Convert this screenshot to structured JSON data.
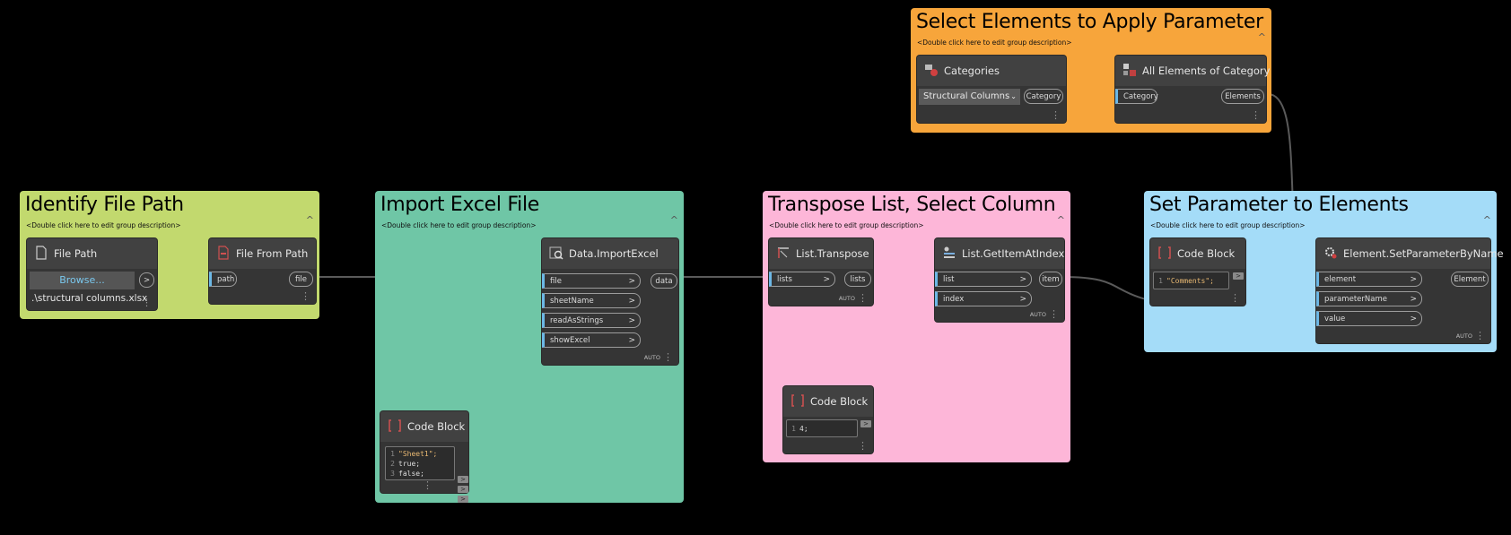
{
  "groups": {
    "select_elements": {
      "title": "Select Elements to Apply Parameter",
      "desc": "<Double click here to edit group description>",
      "color": "#f7a53b"
    },
    "identify_path": {
      "title": "Identify File Path",
      "desc": "<Double click here to edit group description>",
      "color": "#c2d96e"
    },
    "import_excel": {
      "title": "Import Excel File",
      "desc": "<Double click here to edit group description>",
      "color": "#6fc6a6"
    },
    "transpose": {
      "title": "Transpose List, Select Column",
      "desc": "<Double click here to edit group description>",
      "color": "#fdb6d8"
    },
    "set_param": {
      "title": "Set Parameter to Elements",
      "desc": "<Double click here to edit group description>",
      "color": "#a4dcf8"
    }
  },
  "nodes": {
    "categories": {
      "title": "Categories",
      "dropdown": "Structural Columns",
      "out": "Category",
      "icon": "categories-icon"
    },
    "all_elements": {
      "title": "All Elements of Category",
      "in": "Category",
      "out": "Elements",
      "icon": "all-elements-icon"
    },
    "file_path": {
      "title": "File Path",
      "button": "Browse...",
      "out": ">",
      "value": ".\\structural columns.xlsx",
      "icon": "file-icon"
    },
    "file_from_path": {
      "title": "File From Path",
      "in": "path",
      "out": "file",
      "icon": "file-from-path-icon"
    },
    "import_excel": {
      "title": "Data.ImportExcel",
      "inputs": [
        "file",
        "sheetName",
        "readAsStrings",
        "showExcel"
      ],
      "out": "data",
      "lacing": "AUTO",
      "icon": "import-excel-icon"
    },
    "code_block_1": {
      "title": "Code Block",
      "lines": [
        "\"Sheet1\";",
        "true;",
        "false;"
      ]
    },
    "transpose": {
      "title": "List.Transpose",
      "in": "lists",
      "out": "lists",
      "lacing": "AUTO",
      "icon": "transpose-icon"
    },
    "get_item": {
      "title": "List.GetItemAtIndex",
      "inputs": [
        "list",
        "index"
      ],
      "out": "item",
      "lacing": "AUTO",
      "icon": "get-item-icon"
    },
    "code_block_2": {
      "title": "Code Block",
      "lines": [
        "4;"
      ]
    },
    "code_block_3": {
      "title": "Code Block",
      "lines": [
        "\"Comments\";"
      ]
    },
    "set_param": {
      "title": "Element.SetParameterByName",
      "inputs": [
        "element",
        "parameterName",
        "value"
      ],
      "out": "Element",
      "lacing": "AUTO",
      "icon": "set-param-icon"
    }
  },
  "port_arrow": ">",
  "collapse_icon": "^",
  "line_numbers": [
    "1",
    "2",
    "3"
  ]
}
